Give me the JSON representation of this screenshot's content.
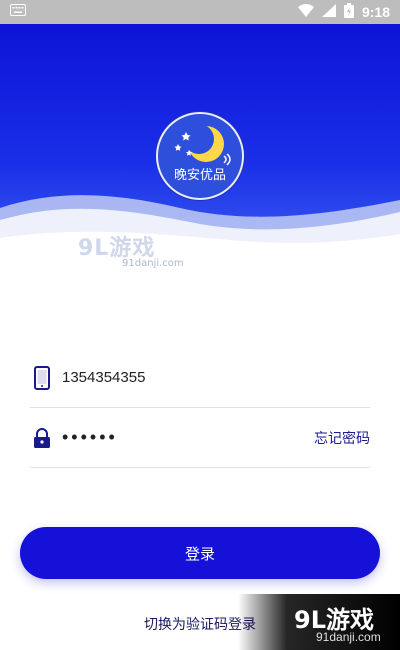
{
  "status_bar": {
    "time": "9:18",
    "icons": [
      "keyboard-icon",
      "wifi-icon",
      "signal-icon",
      "battery-charging-icon"
    ]
  },
  "logo": {
    "text": "晚安优品",
    "icons": [
      "moon-icon",
      "star-icon"
    ]
  },
  "watermark_top": {
    "main": "9L游戏",
    "sub": "91danji.com"
  },
  "login_form": {
    "phone_value": "1354354355",
    "password_value": "••••••",
    "forgot_password_label": "忘记密码",
    "login_button_label": "登录",
    "switch_link_label": "切换为验证码登录"
  },
  "watermark_bottom": {
    "main": "9L游戏",
    "sub": "91danji.com"
  },
  "colors": {
    "primary": "#1511d8",
    "hero_top": "#0d13d6",
    "hero_bottom": "#3a5cf0",
    "icon_blue": "#1a1a8c"
  }
}
